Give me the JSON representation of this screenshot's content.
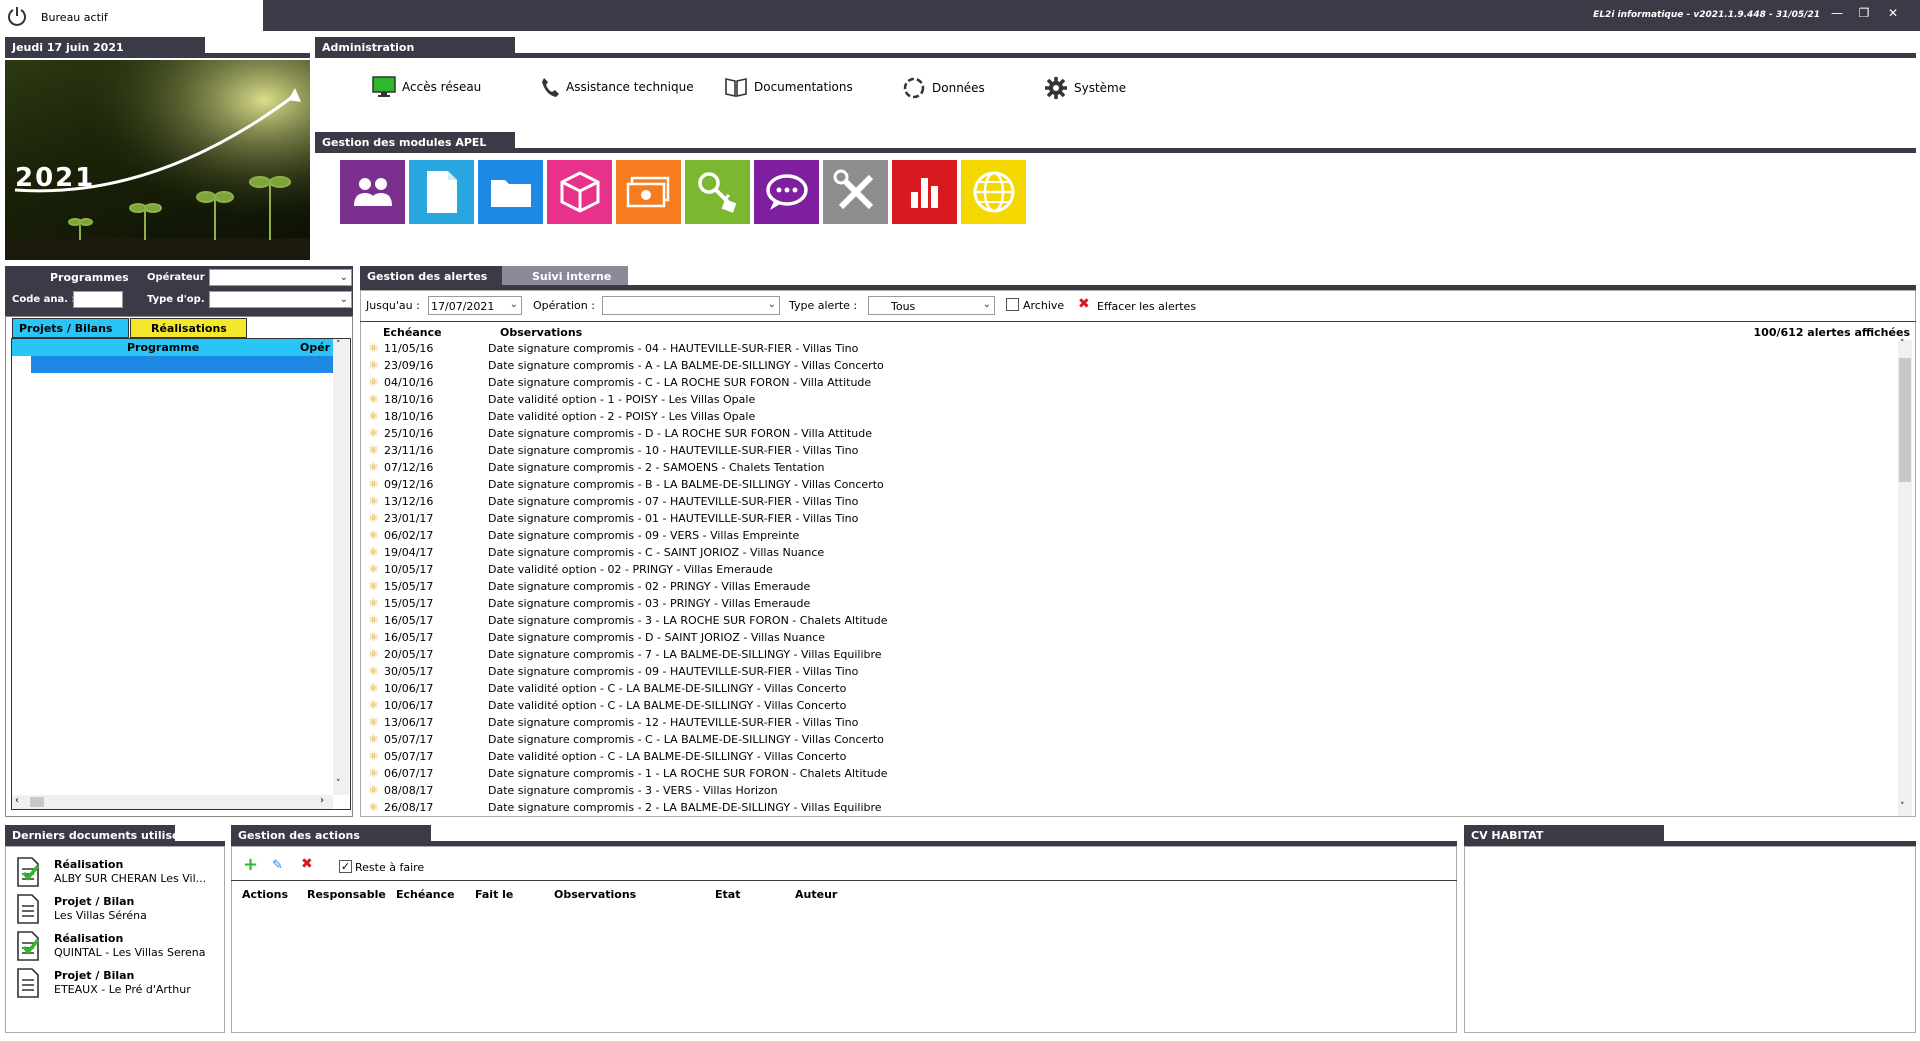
{
  "app": {
    "tab": "Bureau actif",
    "version": "EL2i informatique - v2021.1.9.448 - 31/05/21"
  },
  "date_panel": {
    "date": "Jeudi 17 juin 2021",
    "year": "2021"
  },
  "admin": {
    "title": "Administration",
    "items": [
      {
        "label": "Accès réseau",
        "icon": "monitor-icon"
      },
      {
        "label": "Assistance technique",
        "icon": "phone-icon"
      },
      {
        "label": "Documentations",
        "icon": "book-icon"
      },
      {
        "label": "Données",
        "icon": "refresh-icon"
      },
      {
        "label": "Système",
        "icon": "gear-icon"
      }
    ]
  },
  "modules": {
    "title": "Gestion des modules APEL",
    "items": [
      {
        "icon": "users-icon",
        "color": "#7b2f8f"
      },
      {
        "icon": "document-icon",
        "color": "#29a6e0"
      },
      {
        "icon": "folder-icon",
        "color": "#1e88e5"
      },
      {
        "icon": "cube-icon",
        "color": "#e8318a"
      },
      {
        "icon": "money-icon",
        "color": "#f57c1f"
      },
      {
        "icon": "key-icon",
        "color": "#7cb82f"
      },
      {
        "icon": "chat-icon",
        "color": "#7e1fa0"
      },
      {
        "icon": "tools-icon",
        "color": "#8e8e8e"
      },
      {
        "icon": "chart-icon",
        "color": "#d71920"
      },
      {
        "icon": "globe-icon",
        "color": "#f5d800"
      }
    ]
  },
  "programmes": {
    "title": "Programmes",
    "operateur_label": "Opérateur :",
    "code_label": "Code ana. :",
    "type_label": "Type d'op. :",
    "tab_projets": "Projets / Bilans",
    "tab_realisations": "Réalisations",
    "col_programme": "Programme",
    "col_oper": "Opér"
  },
  "alerts": {
    "tab_gestion": "Gestion des alertes",
    "tab_suivi": "Suivi interne",
    "jusquau_label": "Jusqu'au :",
    "jusquau_value": "17/07/2021",
    "operation_label": "Opération :",
    "type_label": "Type alerte :",
    "type_value": "Tous",
    "archive_label": "Archive",
    "effacer_label": "Effacer les alertes",
    "col_echeance": "Echéance",
    "col_observations": "Observations",
    "count": "100/612 alertes affichées",
    "rows": [
      {
        "d": "11/05/16",
        "o": "Date signature compromis - 04 - HAUTEVILLE-SUR-FIER - Villas Tino"
      },
      {
        "d": "23/09/16",
        "o": "Date signature compromis - A - LA BALME-DE-SILLINGY - Villas Concerto"
      },
      {
        "d": "04/10/16",
        "o": "Date signature compromis - C - LA ROCHE SUR FORON - Villa Attitude"
      },
      {
        "d": "18/10/16",
        "o": "Date validité option - 1 - POISY - Les Villas Opale"
      },
      {
        "d": "18/10/16",
        "o": "Date validité option - 2 - POISY - Les Villas Opale"
      },
      {
        "d": "25/10/16",
        "o": "Date signature compromis - D - LA ROCHE SUR FORON - Villa Attitude"
      },
      {
        "d": "23/11/16",
        "o": "Date signature compromis - 10 - HAUTEVILLE-SUR-FIER - Villas Tino"
      },
      {
        "d": "07/12/16",
        "o": "Date signature compromis - 2 - SAMOENS - Chalets Tentation"
      },
      {
        "d": "09/12/16",
        "o": "Date signature compromis - B - LA BALME-DE-SILLINGY - Villas Concerto"
      },
      {
        "d": "13/12/16",
        "o": "Date signature compromis - 07 - HAUTEVILLE-SUR-FIER - Villas Tino"
      },
      {
        "d": "23/01/17",
        "o": "Date signature compromis - 01 - HAUTEVILLE-SUR-FIER - Villas Tino"
      },
      {
        "d": "06/02/17",
        "o": "Date signature compromis - 09 - VERS - Villas Empreinte"
      },
      {
        "d": "19/04/17",
        "o": "Date signature compromis - C - SAINT JORIOZ - Villas Nuance"
      },
      {
        "d": "10/05/17",
        "o": "Date validité option - 02 - PRINGY - Villas Emeraude"
      },
      {
        "d": "15/05/17",
        "o": "Date signature compromis - 02 - PRINGY - Villas Emeraude"
      },
      {
        "d": "15/05/17",
        "o": "Date signature compromis - 03 - PRINGY - Villas Emeraude"
      },
      {
        "d": "16/05/17",
        "o": "Date signature compromis - 3 - LA ROCHE SUR FORON - Chalets Altitude"
      },
      {
        "d": "16/05/17",
        "o": "Date signature compromis - D - SAINT JORIOZ - Villas Nuance"
      },
      {
        "d": "20/05/17",
        "o": "Date signature compromis - 7 - LA BALME-DE-SILLINGY - Villas Equilibre"
      },
      {
        "d": "30/05/17",
        "o": "Date signature compromis - 09 - HAUTEVILLE-SUR-FIER - Villas Tino"
      },
      {
        "d": "10/06/17",
        "o": "Date validité option - C - LA BALME-DE-SILLINGY - Villas Concerto"
      },
      {
        "d": "10/06/17",
        "o": "Date validité option - C - LA BALME-DE-SILLINGY - Villas Concerto"
      },
      {
        "d": "13/06/17",
        "o": "Date signature compromis - 12 - HAUTEVILLE-SUR-FIER - Villas Tino"
      },
      {
        "d": "05/07/17",
        "o": "Date signature compromis - C - LA BALME-DE-SILLINGY - Villas Concerto"
      },
      {
        "d": "05/07/17",
        "o": "Date validité option - C - LA BALME-DE-SILLINGY - Villas Concerto"
      },
      {
        "d": "06/07/17",
        "o": "Date signature compromis - 1 - LA ROCHE SUR FORON - Chalets Altitude"
      },
      {
        "d": "08/08/17",
        "o": "Date signature compromis - 3 - VERS - Villas Horizon"
      },
      {
        "d": "26/08/17",
        "o": "Date signature compromis - 2 - LA BALME-DE-SILLINGY - Villas Equilibre"
      }
    ]
  },
  "documents": {
    "title": "Derniers documents utilisés",
    "items": [
      {
        "type": "Réalisation",
        "name": "ALBY SUR CHERAN Les Vil...",
        "icon": "document-check-icon"
      },
      {
        "type": "Projet / Bilan",
        "name": "Les Villas Séréna",
        "icon": "document-icon"
      },
      {
        "type": "Réalisation",
        "name": "QUINTAL - Les Villas Serena",
        "icon": "document-check-icon"
      },
      {
        "type": "Projet / Bilan",
        "name": "ETEAUX - Le Pré d'Arthur",
        "icon": "document-icon"
      }
    ]
  },
  "actions": {
    "title": "Gestion des actions",
    "reste_label": "Reste à faire",
    "columns": [
      "Actions",
      "Responsable",
      "Echéance",
      "Fait le",
      "Observations",
      "Etat",
      "Auteur"
    ]
  },
  "cv": {
    "title": "CV HABITAT"
  }
}
